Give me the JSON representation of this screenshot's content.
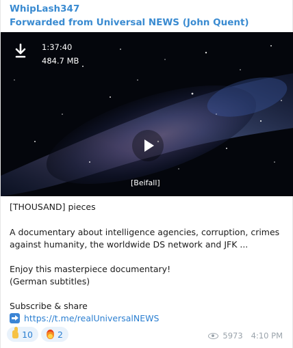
{
  "message": {
    "sender": "WhipLash347",
    "forwarded_from": "Forwarded from Universal NEWS (John Quent)",
    "video": {
      "duration": "1:37:40",
      "size": "484.7 MB",
      "subtitle": "[Beifall]"
    },
    "caption": {
      "line1": "[THOUSAND] pieces",
      "line2": "A documentary about intelligence agencies, corruption, crimes",
      "line3": "against humanity, the worldwide DS network and JFK ...",
      "line4": "Enjoy this masterpiece documentary!",
      "line5": "(German subtitles)",
      "line6": "Subscribe & share",
      "link": "https://t.me/realUniversalNEWS"
    },
    "reactions": [
      {
        "emoji": "thumbs-up",
        "count": "10"
      },
      {
        "emoji": "fire",
        "count": "2"
      }
    ],
    "views": "5973",
    "time": "4:10 PM"
  },
  "colors": {
    "accent": "#3a8bd1",
    "link": "#2b7fd1",
    "meta": "#9aa3ab"
  }
}
